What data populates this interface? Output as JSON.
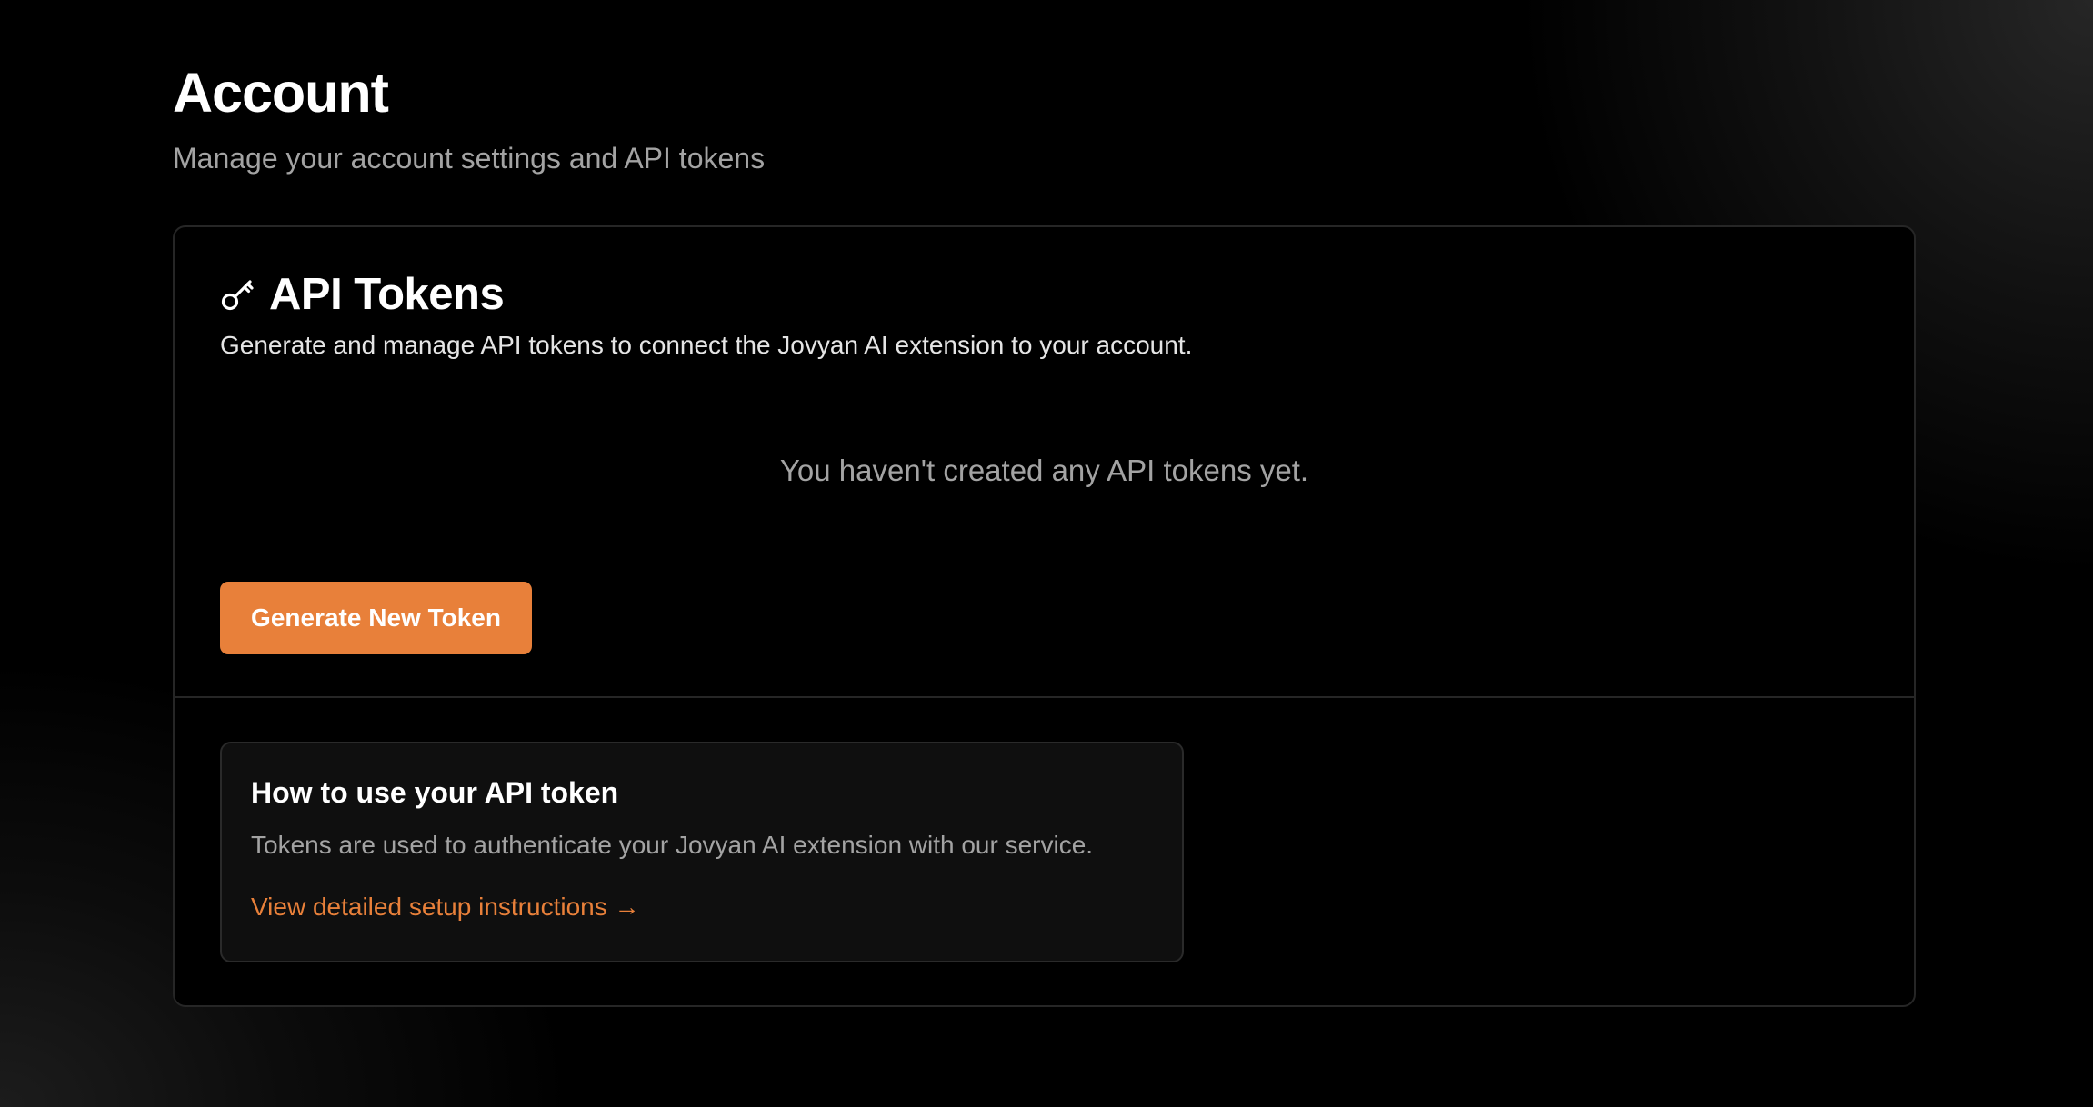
{
  "page": {
    "title": "Account",
    "subtitle": "Manage your account settings and API tokens"
  },
  "api_tokens": {
    "icon": "key-icon",
    "title": "API Tokens",
    "description": "Generate and manage API tokens to connect the Jovyan AI extension to your account.",
    "empty_message": "You haven't created any API tokens yet.",
    "generate_button_label": "Generate New Token"
  },
  "help": {
    "title": "How to use your API token",
    "text": "Tokens are used to authenticate your Jovyan AI extension with our service.",
    "link_label": "View detailed setup instructions →"
  },
  "colors": {
    "background": "#000000",
    "accent": "#e8803a",
    "muted_text": "#a3a3a3",
    "border": "#262626"
  }
}
